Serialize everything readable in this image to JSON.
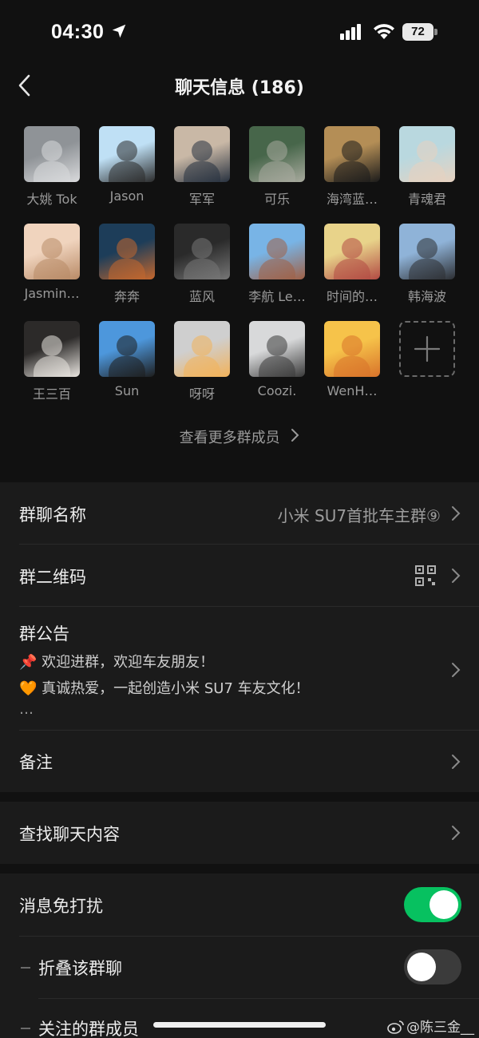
{
  "status_bar": {
    "time": "04:30",
    "battery": "72"
  },
  "nav": {
    "title": "聊天信息 (186)"
  },
  "members": [
    {
      "name": "大姚 Tok",
      "colors": [
        "#8f9397",
        "#d9dadc"
      ]
    },
    {
      "name": "Jason",
      "colors": [
        "#bfe0f5",
        "#2b2b2b"
      ]
    },
    {
      "name": "军军",
      "colors": [
        "#c9b8a6",
        "#27313f"
      ]
    },
    {
      "name": "可乐",
      "colors": [
        "#47664a",
        "#a8aa9e"
      ]
    },
    {
      "name": "海湾蓝…",
      "colors": [
        "#b48e56",
        "#1b1b1b"
      ]
    },
    {
      "name": "青魂君",
      "colors": [
        "#b9d8df",
        "#e7d2c0"
      ]
    },
    {
      "name": "Jasmin…",
      "colors": [
        "#f0d4be",
        "#b88a66"
      ]
    },
    {
      "name": "奔奔",
      "colors": [
        "#1d3d59",
        "#c5672d"
      ]
    },
    {
      "name": "蓝风",
      "colors": [
        "#2a2a2a",
        "#767676"
      ]
    },
    {
      "name": "李航 Le…",
      "colors": [
        "#78b4e6",
        "#a06045"
      ]
    },
    {
      "name": "时间的…",
      "colors": [
        "#e8d38a",
        "#b24a43"
      ]
    },
    {
      "name": "韩海波",
      "colors": [
        "#8fb3d8",
        "#2d2f33"
      ]
    },
    {
      "name": "王三百",
      "colors": [
        "#2c2a29",
        "#e9e5e0"
      ]
    },
    {
      "name": "Sun",
      "colors": [
        "#4d97dc",
        "#1e1e1e"
      ]
    },
    {
      "name": "呀呀",
      "colors": [
        "#cfcfcf",
        "#f2b25a"
      ]
    },
    {
      "name": "Coozi.",
      "colors": [
        "#d8d9da",
        "#3a3a3a"
      ]
    },
    {
      "name": "WenH…",
      "colors": [
        "#f6c34a",
        "#d8722a"
      ]
    }
  ],
  "add_member_label": "add",
  "more_members": "查看更多群成员",
  "group_name": {
    "label": "群聊名称",
    "value": "小米 SU7首批车主群⑨"
  },
  "qr_code": {
    "label": "群二维码"
  },
  "announcement": {
    "label": "群公告",
    "line1_emoji": "📌",
    "line1": "欢迎进群，欢迎车友朋友！",
    "line2_emoji": "🧡",
    "line2": "真诚热爱，一起创造小米 SU7 车友文化！",
    "ellipsis": "…"
  },
  "remark": {
    "label": "备注"
  },
  "search_chat": {
    "label": "查找聊天内容"
  },
  "mute": {
    "label": "消息免打扰",
    "on": true
  },
  "fold": {
    "label": "折叠该群聊",
    "on": false
  },
  "followed_members": {
    "label": "关注的群成员"
  },
  "watermark": "@陈三金__",
  "colors": {
    "accent_green": "#07c160",
    "background": "#111111",
    "section_bg": "#1b1b1b"
  }
}
